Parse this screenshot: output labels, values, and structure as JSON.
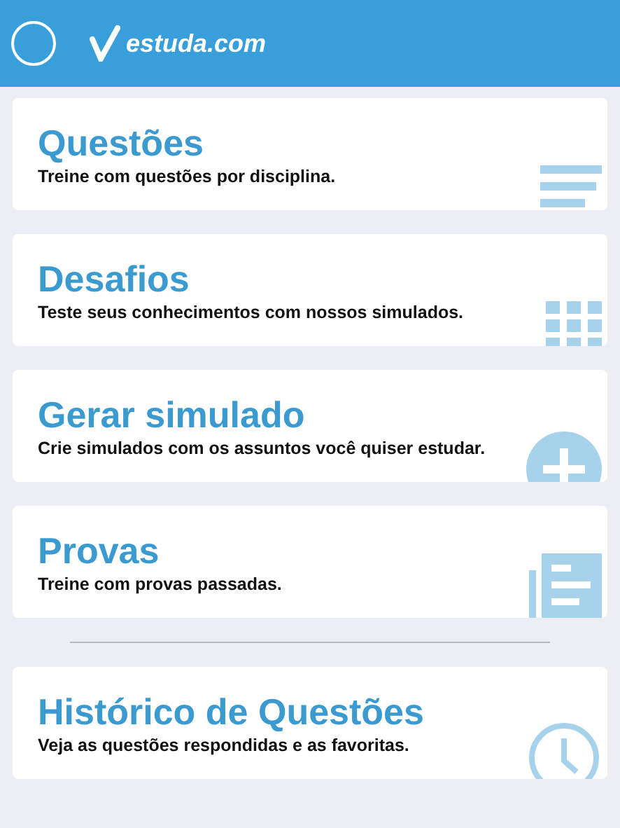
{
  "app_bar": {
    "logo_text": "estuda.com"
  },
  "sections": [
    {
      "cards": [
        {
          "kind": "list",
          "title": "Questões",
          "subtitle": "Treine com questões por disciplina."
        },
        {
          "kind": "grid",
          "title": "Desafios",
          "subtitle": "Teste seus conhecimentos com nossos simulados."
        },
        {
          "kind": "add",
          "title": "Gerar simulado",
          "subtitle": "Crie simulados com os assuntos você quiser estudar."
        },
        {
          "kind": "document",
          "title": "Provas",
          "subtitle": "Treine com provas passadas."
        }
      ]
    },
    {
      "cards": [
        {
          "kind": "history",
          "title": "Histórico de Questões",
          "subtitle": "Veja as questões respondidas e as favoritas."
        }
      ]
    }
  ]
}
